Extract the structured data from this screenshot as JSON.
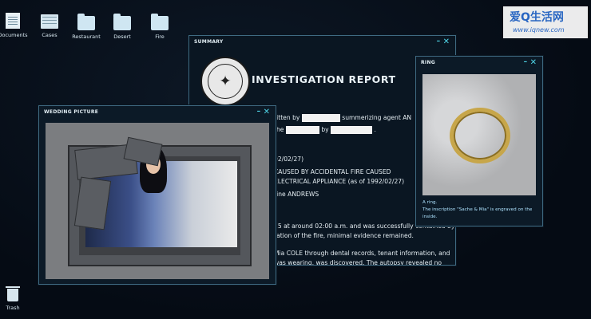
{
  "desktop_icons": [
    {
      "label": "Documents",
      "icon": "document-icon"
    },
    {
      "label": "Cases",
      "icon": "cases-icon"
    },
    {
      "label": "Restaurant",
      "icon": "folder-icon"
    },
    {
      "label": "Desert",
      "icon": "folder-icon"
    },
    {
      "label": "Fire",
      "icon": "folder-icon"
    },
    {
      "label": "Trash",
      "icon": "trash-icon"
    }
  ],
  "summary": {
    "title": "SUMMARY",
    "heading": "INVESTIGATION REPORT",
    "lines": [
      "ritten by",
      "summerizing agent AN",
      "the",
      "by",
      "92/02/27)",
      "CAUSED BY ACCIDENTAL FIRE CAUSED",
      "ELECTRICAL APPLIANCE (as of 1992/02/27)",
      "rine ANDREWS",
      "25 at around 02:00 a.m. and was successfully contained by",
      "ration of the fire, minimal evidence remained.",
      "Mia COLE through dental records, tenant information, and",
      "was wearing, was discovered. The autopsy revealed no"
    ]
  },
  "wedding": {
    "title": "WEDDING PICTURE"
  },
  "ring": {
    "title": "RING",
    "caption1": "A ring.",
    "caption2": "The inscription \"Sache & Mia\" is engraved on the",
    "caption3": "inside."
  },
  "watermark": {
    "line1": "爱Q生活网",
    "line2": "www.iqnew.com"
  },
  "window_controls": {
    "minimize": "–",
    "close": "✕"
  },
  "colors": {
    "accent": "#4fd6e8",
    "window_border": "#3f6a82",
    "background": "#050b14"
  }
}
